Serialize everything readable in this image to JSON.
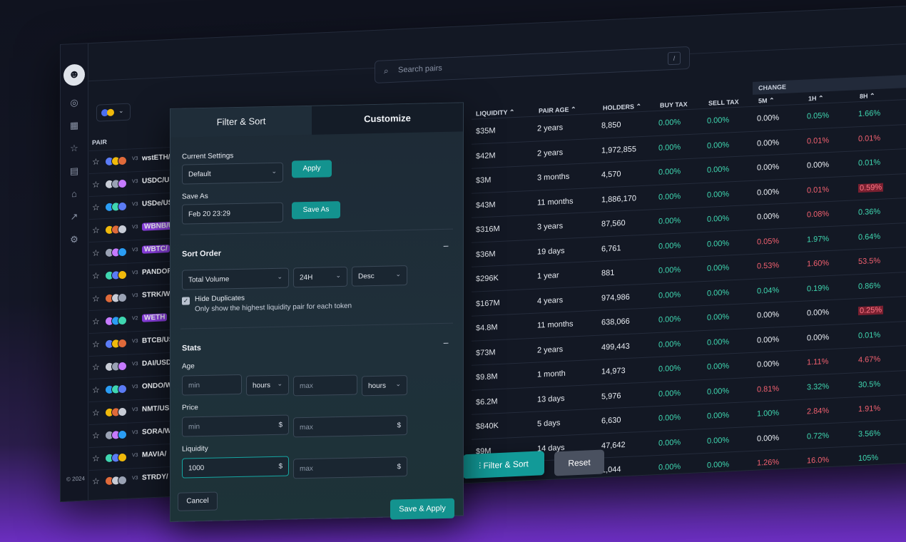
{
  "sidebar": {
    "copyright": "© 2024",
    "icons": [
      "logo-icon",
      "globe-icon",
      "grid-icon",
      "star-icon",
      "wallet-icon",
      "graduation-icon",
      "trending-icon",
      "settings-icon"
    ]
  },
  "search": {
    "placeholder": "Search pairs",
    "shortcut": "/"
  },
  "table": {
    "pair_header": "PAIR",
    "headers": {
      "liquidity": "LIQUIDITY ⌃",
      "pair_age": "PAIR AGE ⌃",
      "holders": "HOLDERS ⌃",
      "buy_tax": "BUY TAX",
      "sell_tax": "SELL TAX",
      "change": "CHANGE",
      "m5": "5M ⌃",
      "h1": "1H ⌃",
      "h8": "8H ⌃"
    },
    "pairs": [
      {
        "name": "wstETH/U",
        "ver": "V3",
        "hl": false
      },
      {
        "name": "USDC/US",
        "ver": "V3",
        "hl": false
      },
      {
        "name": "USDe/US",
        "ver": "V3",
        "hl": false
      },
      {
        "name": "WBNB/U",
        "ver": "V3",
        "hl": true
      },
      {
        "name": "WBTC/",
        "ver": "V3",
        "hl": true
      },
      {
        "name": "PANDOR/",
        "ver": "V3",
        "hl": false
      },
      {
        "name": "STRK/W",
        "ver": "V3",
        "hl": false
      },
      {
        "name": "WETH",
        "ver": "V2",
        "hl": true
      },
      {
        "name": "BTCB/US",
        "ver": "V3",
        "hl": false
      },
      {
        "name": "DAI/USD",
        "ver": "V3",
        "hl": false
      },
      {
        "name": "ONDO/W",
        "ver": "V3",
        "hl": false
      },
      {
        "name": "NMT/US",
        "ver": "V3",
        "hl": false
      },
      {
        "name": "SORA/W",
        "ver": "V3",
        "hl": false
      },
      {
        "name": "MAVIA/",
        "ver": "V3",
        "hl": false
      },
      {
        "name": "STRDY/",
        "ver": "V3",
        "hl": false
      }
    ],
    "rows": [
      {
        "liq": "$35M",
        "age": "2 years",
        "holders": "8,850",
        "buy": "0.00%",
        "sell": "0.00%",
        "m5": "0.00%",
        "h1": "0.05%",
        "h8": "1.66%"
      },
      {
        "liq": "$42M",
        "age": "2 years",
        "holders": "1,972,855",
        "buy": "0.00%",
        "sell": "0.00%",
        "m5": "0.00%",
        "h1": "0.01%",
        "h8": "0.01%"
      },
      {
        "liq": "$3M",
        "age": "3 months",
        "holders": "4,570",
        "buy": "0.00%",
        "sell": "0.00%",
        "m5": "0.00%",
        "h1": "0.00%",
        "h8": "0.01%"
      },
      {
        "liq": "$43M",
        "age": "11 months",
        "holders": "1,886,170",
        "buy": "0.00%",
        "sell": "0.00%",
        "m5": "0.00%",
        "h1": "0.01%",
        "h8": "0.59%"
      },
      {
        "liq": "$316M",
        "age": "3 years",
        "holders": "87,560",
        "buy": "0.00%",
        "sell": "0.00%",
        "m5": "0.00%",
        "h1": "0.08%",
        "h8": "0.36%"
      },
      {
        "liq": "$36M",
        "age": "19 days",
        "holders": "6,761",
        "buy": "0.00%",
        "sell": "0.00%",
        "m5": "0.05%",
        "h1": "1.97%",
        "h8": "0.64%"
      },
      {
        "liq": "$296K",
        "age": "1 year",
        "holders": "881",
        "buy": "0.00%",
        "sell": "0.00%",
        "m5": "0.53%",
        "h1": "1.60%",
        "h8": "53.5%"
      },
      {
        "liq": "$167M",
        "age": "4 years",
        "holders": "974,986",
        "buy": "0.00%",
        "sell": "0.00%",
        "m5": "0.04%",
        "h1": "0.19%",
        "h8": "0.86%"
      },
      {
        "liq": "$4.8M",
        "age": "11 months",
        "holders": "638,066",
        "buy": "0.00%",
        "sell": "0.00%",
        "m5": "0.00%",
        "h1": "0.00%",
        "h8": "0.25%"
      },
      {
        "liq": "$73M",
        "age": "2 years",
        "holders": "499,443",
        "buy": "0.00%",
        "sell": "0.00%",
        "m5": "0.00%",
        "h1": "0.00%",
        "h8": "0.01%"
      },
      {
        "liq": "$9.8M",
        "age": "1 month",
        "holders": "14,973",
        "buy": "0.00%",
        "sell": "0.00%",
        "m5": "0.00%",
        "h1": "1.11%",
        "h8": "4.67%"
      },
      {
        "liq": "$6.2M",
        "age": "13 days",
        "holders": "5,976",
        "buy": "0.00%",
        "sell": "0.00%",
        "m5": "0.81%",
        "h1": "3.32%",
        "h8": "30.5%"
      },
      {
        "liq": "$840K",
        "age": "5 days",
        "holders": "6,630",
        "buy": "0.00%",
        "sell": "0.00%",
        "m5": "1.00%",
        "h1": "2.84%",
        "h8": "1.91%"
      },
      {
        "liq": "$9M",
        "age": "14 days",
        "holders": "47,642",
        "buy": "0.00%",
        "sell": "0.00%",
        "m5": "0.00%",
        "h1": "0.72%",
        "h8": "3.56%"
      },
      {
        "liq": "",
        "age": "",
        "holders": "1,044",
        "buy": "0.00%",
        "sell": "0.00%",
        "m5": "1.26%",
        "h1": "16.0%",
        "h8": "105%"
      }
    ],
    "colors": {
      "m5": [
        "w",
        "w",
        "w",
        "w",
        "w",
        "r",
        "r",
        "g",
        "w",
        "w",
        "w",
        "r",
        "g",
        "w",
        "r"
      ],
      "h1": [
        "g",
        "r",
        "w",
        "r",
        "r",
        "g",
        "r",
        "g",
        "w",
        "w",
        "r",
        "g",
        "r",
        "g",
        "r"
      ],
      "h8": [
        "g",
        "r",
        "g",
        "rbg",
        "g",
        "g",
        "r",
        "g",
        "rbg",
        "g",
        "r",
        "g",
        "r",
        "g",
        "g"
      ]
    }
  },
  "bottom_buttons": {
    "filter": "Filter & Sort",
    "reset": "Reset"
  },
  "modal": {
    "tab_filter": "Filter & Sort",
    "tab_customize": "Customize",
    "current_settings_label": "Current Settings",
    "current_settings_value": "Default",
    "apply": "Apply",
    "save_as_label": "Save As",
    "save_as_value": "Feb 20 23:29",
    "save_as_button": "Save As",
    "sort_order": "Sort Order",
    "sort_field": "Total Volume",
    "sort_window": "24H",
    "sort_dir": "Desc",
    "hide_duplicates": "Hide Duplicates",
    "hide_duplicates_desc": "Only show the highest liquidity pair for each token",
    "stats": "Stats",
    "age_label": "Age",
    "age_min_ph": "min",
    "age_min_unit": "hours",
    "age_max_ph": "max",
    "age_max_unit": "hours",
    "price_label": "Price",
    "price_min_ph": "min",
    "price_max_ph": "max",
    "currency": "$",
    "liquidity_label": "Liquidity",
    "liquidity_min": "1000",
    "liquidity_max_ph": "max",
    "cancel": "Cancel",
    "save_apply": "Save & Apply"
  },
  "theme": {
    "accent": "#13938f",
    "green": "#3fd6b0",
    "red": "#f0606f",
    "purple": "#8a3ee0"
  }
}
